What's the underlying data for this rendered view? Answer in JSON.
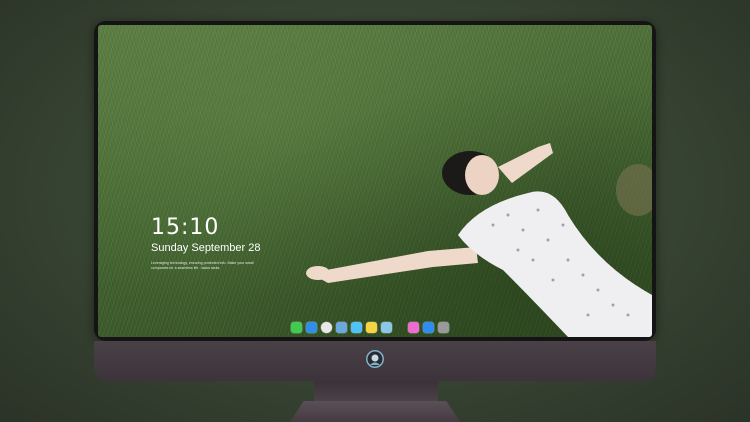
{
  "lockscreen": {
    "time": "15:10",
    "date": "Sunday September 28",
    "caption": "Leveraging technology, ensuring protected info. Make your small companies for a seamless life - tasks tasks."
  },
  "dock": {
    "apps": [
      {
        "name": "messages-icon",
        "color": "#3ecb4f"
      },
      {
        "name": "finder-icon",
        "color": "#2f8ee8"
      },
      {
        "name": "clock-icon",
        "color": "#e8e8e8"
      },
      {
        "name": "news-icon",
        "color": "#6aa9e0"
      },
      {
        "name": "video-icon",
        "color": "#4fc3f7"
      },
      {
        "name": "notes-icon",
        "color": "#f5d442"
      },
      {
        "name": "photos-icon",
        "color": "#8cc7e8"
      },
      {
        "name": "music-icon",
        "color": "#f06bd0"
      },
      {
        "name": "app-store-icon",
        "color": "#2e8df0"
      },
      {
        "name": "camera-icon",
        "color": "#9a9a9a"
      }
    ]
  }
}
